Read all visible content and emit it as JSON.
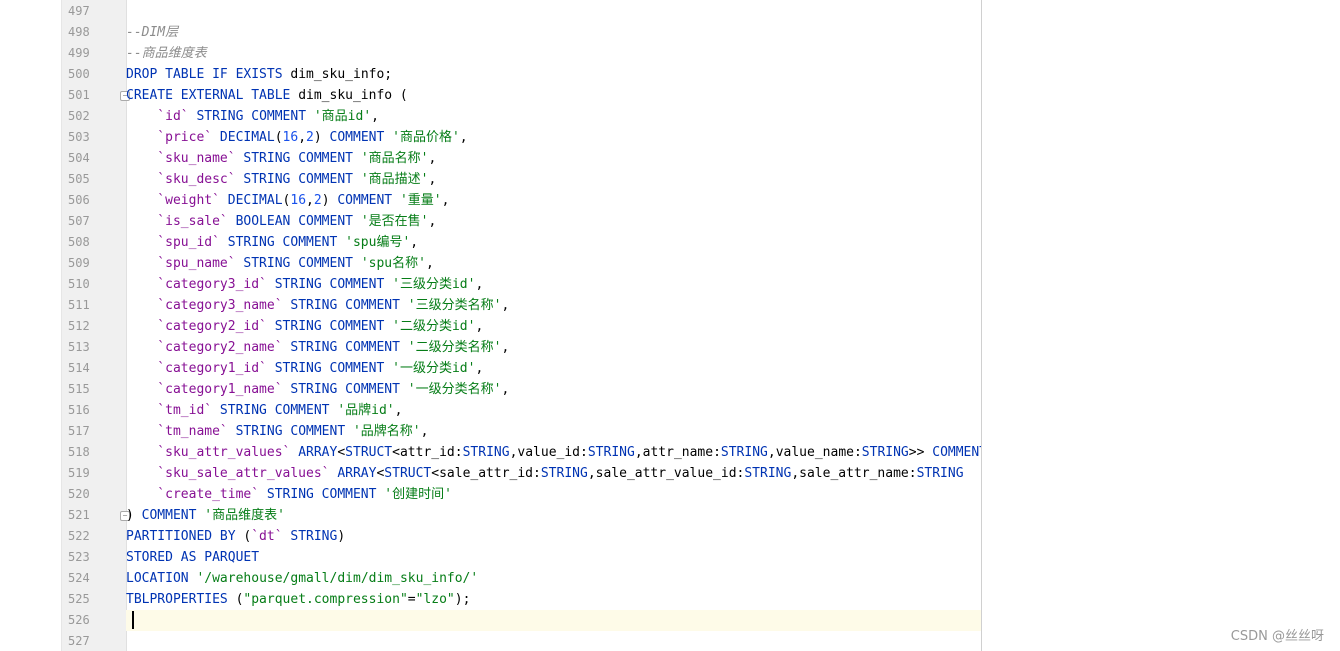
{
  "lines": [
    {
      "num": "497",
      "fold": "",
      "tokens": []
    },
    {
      "num": "498",
      "fold": "",
      "tokens": [
        {
          "t": "cm",
          "v": "--DIM层"
        }
      ]
    },
    {
      "num": "499",
      "fold": "",
      "tokens": [
        {
          "t": "cm",
          "v": "--商品维度表"
        }
      ]
    },
    {
      "num": "500",
      "fold": "",
      "tokens": [
        {
          "t": "kw",
          "v": "DROP TABLE IF EXISTS "
        },
        {
          "t": "tx",
          "v": "dim_sku_info;"
        }
      ]
    },
    {
      "num": "501",
      "fold": "−",
      "tokens": [
        {
          "t": "kw",
          "v": "CREATE EXTERNAL TABLE "
        },
        {
          "t": "tx",
          "v": "dim_sku_info ("
        }
      ]
    },
    {
      "num": "502",
      "fold": "",
      "tokens": [
        {
          "t": "id",
          "v": "    `id`"
        },
        {
          "t": "kw",
          "v": " STRING COMMENT "
        },
        {
          "t": "str",
          "v": "'商品id'"
        },
        {
          "t": "tx",
          "v": ","
        }
      ]
    },
    {
      "num": "503",
      "fold": "",
      "tokens": [
        {
          "t": "id",
          "v": "    `price`"
        },
        {
          "t": "kw",
          "v": " DECIMAL"
        },
        {
          "t": "tx",
          "v": "("
        },
        {
          "t": "num",
          "v": "16"
        },
        {
          "t": "tx",
          "v": ","
        },
        {
          "t": "num",
          "v": "2"
        },
        {
          "t": "tx",
          "v": ")"
        },
        {
          "t": "kw",
          "v": " COMMENT "
        },
        {
          "t": "str",
          "v": "'商品价格'"
        },
        {
          "t": "tx",
          "v": ","
        }
      ]
    },
    {
      "num": "504",
      "fold": "",
      "tokens": [
        {
          "t": "id",
          "v": "    `sku_name`"
        },
        {
          "t": "kw",
          "v": " STRING COMMENT "
        },
        {
          "t": "str",
          "v": "'商品名称'"
        },
        {
          "t": "tx",
          "v": ","
        }
      ]
    },
    {
      "num": "505",
      "fold": "",
      "tokens": [
        {
          "t": "id",
          "v": "    `sku_desc`"
        },
        {
          "t": "kw",
          "v": " STRING COMMENT "
        },
        {
          "t": "str",
          "v": "'商品描述'"
        },
        {
          "t": "tx",
          "v": ","
        }
      ]
    },
    {
      "num": "506",
      "fold": "",
      "tokens": [
        {
          "t": "id",
          "v": "    `weight`"
        },
        {
          "t": "kw",
          "v": " DECIMAL"
        },
        {
          "t": "tx",
          "v": "("
        },
        {
          "t": "num",
          "v": "16"
        },
        {
          "t": "tx",
          "v": ","
        },
        {
          "t": "num",
          "v": "2"
        },
        {
          "t": "tx",
          "v": ")"
        },
        {
          "t": "kw",
          "v": " COMMENT "
        },
        {
          "t": "str",
          "v": "'重量'"
        },
        {
          "t": "tx",
          "v": ","
        }
      ]
    },
    {
      "num": "507",
      "fold": "",
      "tokens": [
        {
          "t": "id",
          "v": "    `is_sale`"
        },
        {
          "t": "kw",
          "v": " BOOLEAN COMMENT "
        },
        {
          "t": "str",
          "v": "'是否在售'"
        },
        {
          "t": "tx",
          "v": ","
        }
      ]
    },
    {
      "num": "508",
      "fold": "",
      "tokens": [
        {
          "t": "id",
          "v": "    `spu_id`"
        },
        {
          "t": "kw",
          "v": " STRING COMMENT "
        },
        {
          "t": "str",
          "v": "'spu编号'"
        },
        {
          "t": "tx",
          "v": ","
        }
      ]
    },
    {
      "num": "509",
      "fold": "",
      "tokens": [
        {
          "t": "id",
          "v": "    `spu_name`"
        },
        {
          "t": "kw",
          "v": " STRING COMMENT "
        },
        {
          "t": "str",
          "v": "'spu名称'"
        },
        {
          "t": "tx",
          "v": ","
        }
      ]
    },
    {
      "num": "510",
      "fold": "",
      "tokens": [
        {
          "t": "id",
          "v": "    `category3_id`"
        },
        {
          "t": "kw",
          "v": " STRING COMMENT "
        },
        {
          "t": "str",
          "v": "'三级分类id'"
        },
        {
          "t": "tx",
          "v": ","
        }
      ]
    },
    {
      "num": "511",
      "fold": "",
      "tokens": [
        {
          "t": "id",
          "v": "    `category3_name`"
        },
        {
          "t": "kw",
          "v": " STRING COMMENT "
        },
        {
          "t": "str",
          "v": "'三级分类名称'"
        },
        {
          "t": "tx",
          "v": ","
        }
      ]
    },
    {
      "num": "512",
      "fold": "",
      "tokens": [
        {
          "t": "id",
          "v": "    `category2_id`"
        },
        {
          "t": "kw",
          "v": " STRING COMMENT "
        },
        {
          "t": "str",
          "v": "'二级分类id'"
        },
        {
          "t": "tx",
          "v": ","
        }
      ]
    },
    {
      "num": "513",
      "fold": "",
      "tokens": [
        {
          "t": "id",
          "v": "    `category2_name`"
        },
        {
          "t": "kw",
          "v": " STRING COMMENT "
        },
        {
          "t": "str",
          "v": "'二级分类名称'"
        },
        {
          "t": "tx",
          "v": ","
        }
      ]
    },
    {
      "num": "514",
      "fold": "",
      "tokens": [
        {
          "t": "id",
          "v": "    `category1_id`"
        },
        {
          "t": "kw",
          "v": " STRING COMMENT "
        },
        {
          "t": "str",
          "v": "'一级分类id'"
        },
        {
          "t": "tx",
          "v": ","
        }
      ]
    },
    {
      "num": "515",
      "fold": "",
      "tokens": [
        {
          "t": "id",
          "v": "    `category1_name`"
        },
        {
          "t": "kw",
          "v": " STRING COMMENT "
        },
        {
          "t": "str",
          "v": "'一级分类名称'"
        },
        {
          "t": "tx",
          "v": ","
        }
      ]
    },
    {
      "num": "516",
      "fold": "",
      "tokens": [
        {
          "t": "id",
          "v": "    `tm_id`"
        },
        {
          "t": "kw",
          "v": " STRING COMMENT "
        },
        {
          "t": "str",
          "v": "'品牌id'"
        },
        {
          "t": "tx",
          "v": ","
        }
      ]
    },
    {
      "num": "517",
      "fold": "",
      "tokens": [
        {
          "t": "id",
          "v": "    `tm_name`"
        },
        {
          "t": "kw",
          "v": " STRING COMMENT "
        },
        {
          "t": "str",
          "v": "'品牌名称'"
        },
        {
          "t": "tx",
          "v": ","
        }
      ]
    },
    {
      "num": "518",
      "fold": "",
      "tokens": [
        {
          "t": "id",
          "v": "    `sku_attr_values`"
        },
        {
          "t": "kw",
          "v": " ARRAY"
        },
        {
          "t": "tx",
          "v": "<"
        },
        {
          "t": "kw",
          "v": "STRUCT"
        },
        {
          "t": "tx",
          "v": "<attr_id:"
        },
        {
          "t": "kw",
          "v": "STRING"
        },
        {
          "t": "tx",
          "v": ",value_id:"
        },
        {
          "t": "kw",
          "v": "STRING"
        },
        {
          "t": "tx",
          "v": ",attr_name:"
        },
        {
          "t": "kw",
          "v": "STRING"
        },
        {
          "t": "tx",
          "v": ",value_name:"
        },
        {
          "t": "kw",
          "v": "STRING"
        },
        {
          "t": "tx",
          "v": ">> "
        },
        {
          "t": "kw",
          "v": "COMMENT"
        }
      ]
    },
    {
      "num": "519",
      "fold": "",
      "tokens": [
        {
          "t": "id",
          "v": "    `sku_sale_attr_values`"
        },
        {
          "t": "kw",
          "v": " ARRAY"
        },
        {
          "t": "tx",
          "v": "<"
        },
        {
          "t": "kw",
          "v": "STRUCT"
        },
        {
          "t": "tx",
          "v": "<sale_attr_id:"
        },
        {
          "t": "kw",
          "v": "STRING"
        },
        {
          "t": "tx",
          "v": ",sale_attr_value_id:"
        },
        {
          "t": "kw",
          "v": "STRING"
        },
        {
          "t": "tx",
          "v": ",sale_attr_name:"
        },
        {
          "t": "kw",
          "v": "STRING"
        }
      ]
    },
    {
      "num": "520",
      "fold": "",
      "tokens": [
        {
          "t": "id",
          "v": "    `create_time`"
        },
        {
          "t": "kw",
          "v": " STRING COMMENT "
        },
        {
          "t": "str",
          "v": "'创建时间'"
        }
      ]
    },
    {
      "num": "521",
      "fold": "−",
      "tokens": [
        {
          "t": "tx",
          "v": ")"
        },
        {
          "t": "kw",
          "v": " COMMENT "
        },
        {
          "t": "str",
          "v": "'商品维度表'"
        }
      ]
    },
    {
      "num": "522",
      "fold": "",
      "tokens": [
        {
          "t": "kw",
          "v": "PARTITIONED BY "
        },
        {
          "t": "tx",
          "v": "("
        },
        {
          "t": "id",
          "v": "`dt`"
        },
        {
          "t": "kw",
          "v": " STRING"
        },
        {
          "t": "tx",
          "v": ")"
        }
      ]
    },
    {
      "num": "523",
      "fold": "",
      "tokens": [
        {
          "t": "kw",
          "v": "STORED AS PARQUET"
        }
      ]
    },
    {
      "num": "524",
      "fold": "",
      "tokens": [
        {
          "t": "kw",
          "v": "LOCATION "
        },
        {
          "t": "str",
          "v": "'/warehouse/gmall/dim/dim_sku_info/'"
        }
      ]
    },
    {
      "num": "525",
      "fold": "",
      "tokens": [
        {
          "t": "kw",
          "v": "TBLPROPERTIES "
        },
        {
          "t": "tx",
          "v": "("
        },
        {
          "t": "str",
          "v": "\"parquet.compression\""
        },
        {
          "t": "tx",
          "v": "="
        },
        {
          "t": "str",
          "v": "\"lzo\""
        },
        {
          "t": "tx",
          "v": ");"
        }
      ]
    },
    {
      "num": "526",
      "fold": "",
      "tokens": [],
      "current": true
    },
    {
      "num": "527",
      "fold": "",
      "tokens": []
    }
  ],
  "watermark": "CSDN @丝丝呀",
  "colors": {
    "keyword": "#0033b3",
    "identifier": "#871094",
    "string": "#067d17",
    "number": "#1750eb",
    "comment": "#8c8c8c",
    "current_line": "#fefbe8"
  }
}
